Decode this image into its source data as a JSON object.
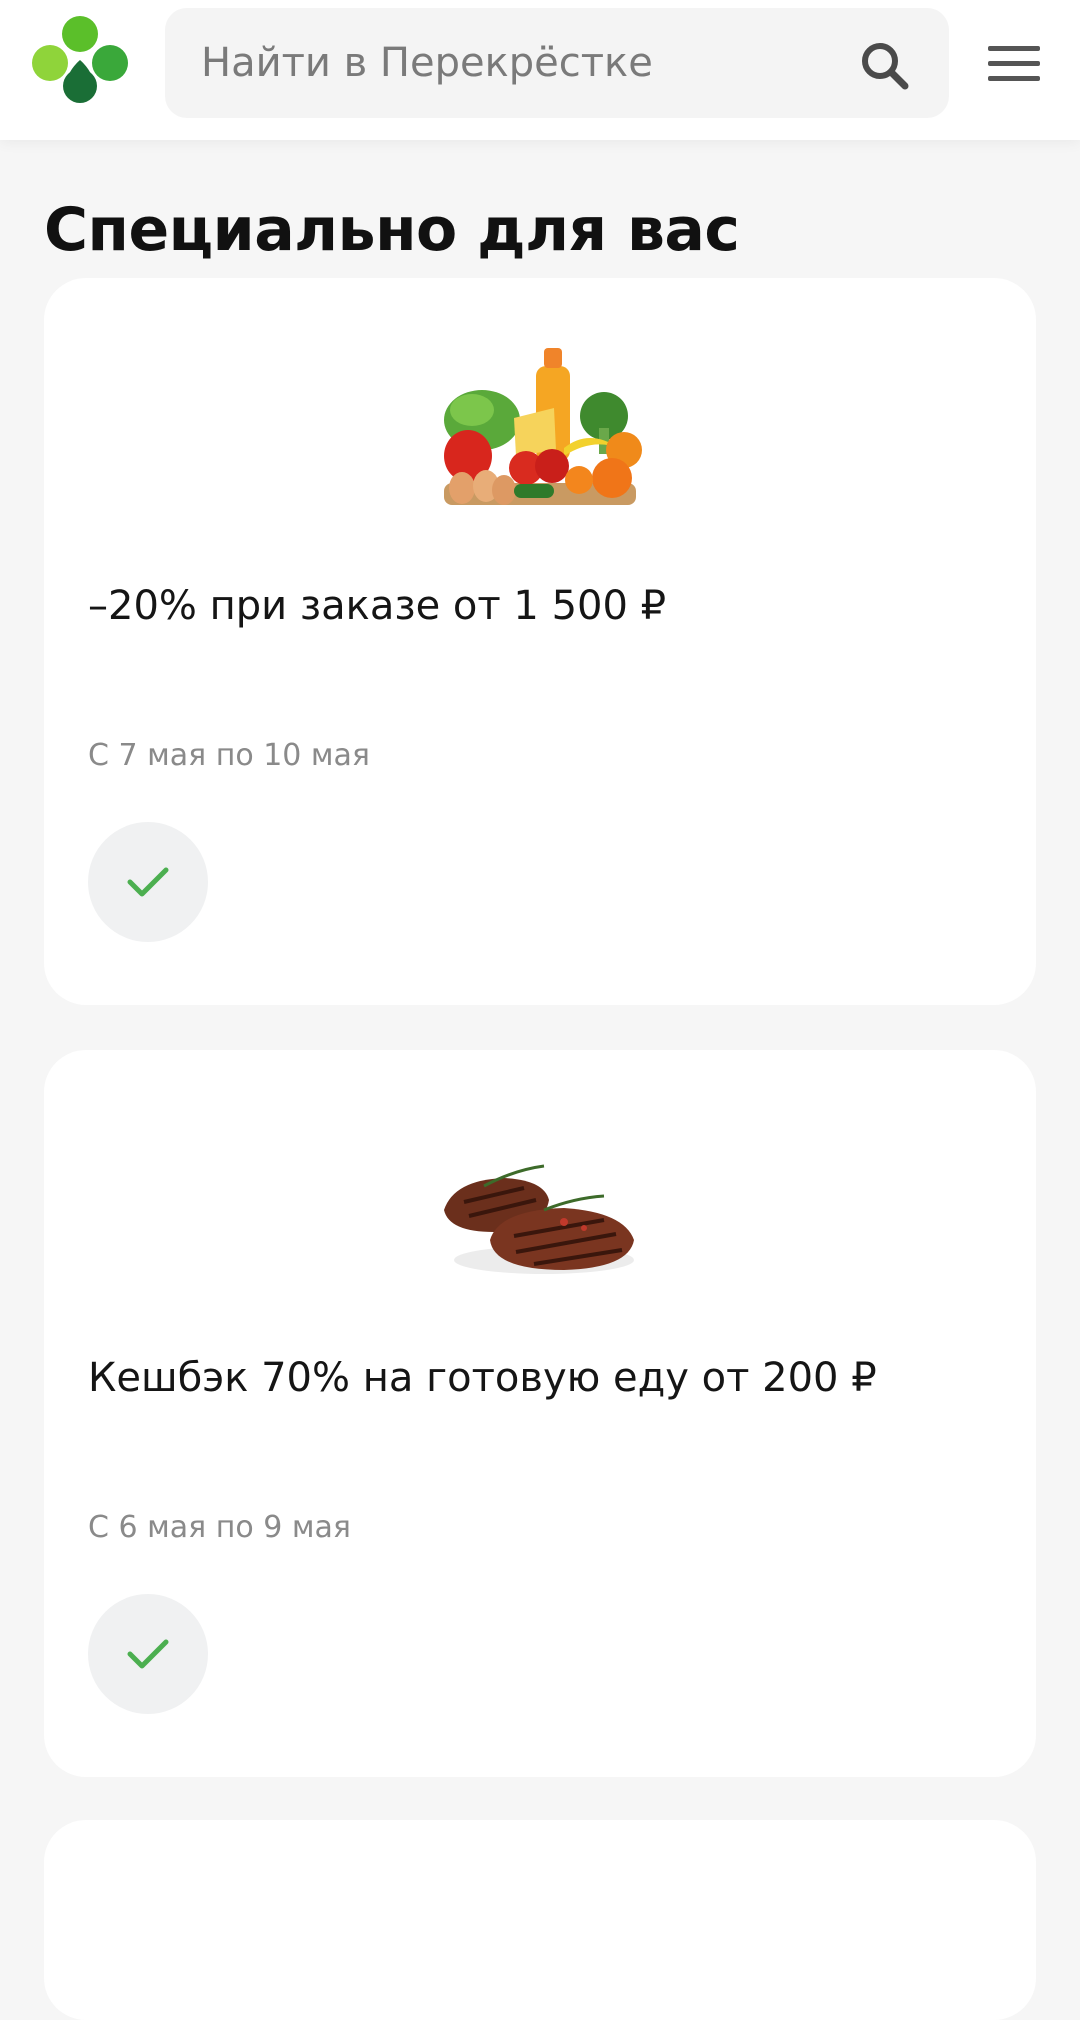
{
  "header": {
    "search": {
      "placeholder": "Найти в Перекрёстке"
    },
    "logo_icon": "clover-logo-icon",
    "search_icon": "search-icon",
    "menu_icon": "hamburger-menu-icon"
  },
  "main": {
    "section_title": "Специально для вас",
    "offers": [
      {
        "title": "–20% при заказе от 1 500 ₽",
        "dates": "С 7 мая по 10 мая",
        "image_icon": "groceries-image",
        "status_icon": "check-icon"
      },
      {
        "title": "Кешбэк 70% на готовую еду от 200 ₽",
        "dates": "С 6 мая по 9 мая",
        "image_icon": "steaks-image",
        "status_icon": "check-icon"
      }
    ]
  },
  "colors": {
    "brand_green": "#5bbf2a",
    "brand_dark_green": "#1a7a3a",
    "check_green": "#4caf50",
    "text_primary": "#151515",
    "text_secondary": "#8a8a8a"
  }
}
